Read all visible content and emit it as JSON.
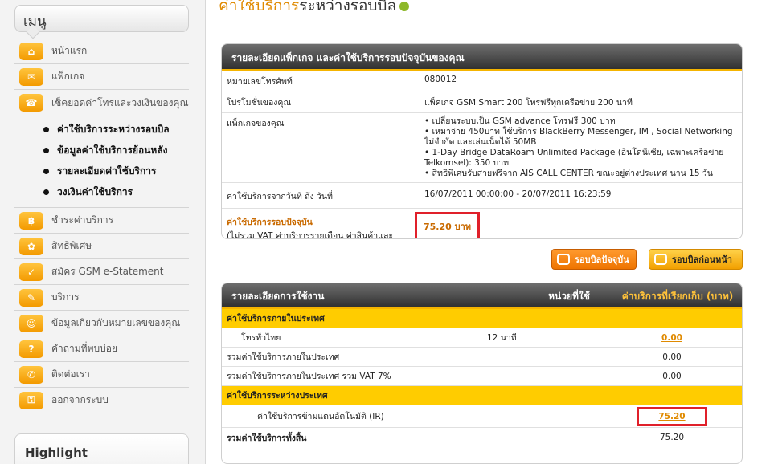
{
  "sidebar": {
    "menu_title": "เมนู",
    "items": [
      {
        "label": "หน้าแรก",
        "icon": "home-icon",
        "glyph": "⌂"
      },
      {
        "label": "แพ็กเกจ",
        "icon": "package-icon",
        "glyph": "✉"
      }
    ],
    "active_item": {
      "label": "เช็คยอดค่าโทรและวงเงินของคุณ",
      "icon": "phone-bill-icon",
      "glyph": "☎"
    },
    "sub_items": [
      "ค่าใช้บริการระหว่างรอบบิล",
      "ข้อมูลค่าใช้บริการย้อนหลัง",
      "รายละเอียดค่าใช้บริการ",
      "วงเงินค่าใช้บริการ"
    ],
    "items_after": [
      {
        "label": "ชำระค่าบริการ",
        "icon": "payment-icon",
        "glyph": "฿"
      },
      {
        "label": "สิทธิพิเศษ",
        "icon": "gift-icon",
        "glyph": "✿"
      },
      {
        "label": "สมัคร GSM e-Statement",
        "icon": "statement-icon",
        "glyph": "✓"
      },
      {
        "label": "บริการ",
        "icon": "service-icon",
        "glyph": "✎"
      },
      {
        "label": "ข้อมูลเกี่ยวกับหมายเลขของคุณ",
        "icon": "user-icon",
        "glyph": "☺"
      },
      {
        "label": "คำถามที่พบบ่อย",
        "icon": "faq-icon",
        "glyph": "?"
      },
      {
        "label": "ติดต่อเรา",
        "icon": "contact-icon",
        "glyph": "✆"
      },
      {
        "label": "ออกจากระบบ",
        "icon": "logout-icon",
        "glyph": "⚿"
      }
    ],
    "highlight_title": "Highlight"
  },
  "main": {
    "title_part1": "ค่าใช้บริการ",
    "title_part2": "ระหว่างรอบบิล",
    "package_panel": {
      "header": "รายละเอียดแพ็กเกจ และค่าใช้บริการรอบปัจจุบันของคุณ",
      "phone_label": "หมายเลขโทรศัพท์",
      "phone_value": "080012",
      "promo_label": "โปรโมชั่นของคุณ",
      "promo_value": "แพ็คเกจ GSM Smart 200 โทรฟรีทุกเครือข่าย 200 นาที",
      "pkg_label": "แพ็กเกจของคุณ",
      "pkg_items": [
        "• เปลี่ยนระบบเป็น GSM advance โทรฟรี 300 บาท",
        "• เหมาจ่าย 450บาท ใช้บริการ BlackBerry Messenger, IM , Social Networking ไม่จำกัด และเล่นเน็ตได้ 50MB",
        "• 1-Day Bridge DataRoam Unlimited Package (อินโดนีเซีย, เฉพาะเครือข่าย Telkomsel): 350 บาท",
        "• สิทธิพิเศษรับสายฟรีจาก AIS CALL CENTER ขณะอยู่ต่างประเทศ นาน 15 วัน"
      ],
      "period_label": "ค่าใช้บริการจากวันที่ ถึง วันที่",
      "period_value": "16/07/2011 00:00:00 - 20/07/2011 16:23:59",
      "current_label": "ค่าใช้บริการรอบปัจจุบัน",
      "current_note": "(ไม่รวม VAT ค่าบริการรายเดือน ค่าสินค้าและบริการ)",
      "current_value": "75.20 บาท"
    },
    "buttons": {
      "current_bill": "รอบบิลปัจจุบัน",
      "previous_bill": "รอบบิลก่อนหน้า"
    },
    "usage_panel": {
      "col_detail": "รายละเอียดการใช้งาน",
      "col_unit": "หน่วยที่ใช้",
      "col_charge": "ค่าบริการที่เรียกเก็บ (บาท)",
      "domestic_section": "ค่าใช้บริการภายในประเทศ",
      "domestic_call_label": "โทรทั่วไทย",
      "domestic_call_unit": "12 นาที",
      "domestic_call_value": "0.00",
      "domestic_total_label": "รวมค่าใช้บริการภายในประเทศ",
      "domestic_total_value": "0.00",
      "domestic_vat_label": "รวมค่าใช้บริการภายในประเทศ รวม VAT 7%",
      "domestic_vat_value": "0.00",
      "intl_section": "ค่าใช้บริการระหว่างประเทศ",
      "ir_label": "ค่าใช้บริการข้ามแดนอัตโนมัติ (IR)",
      "ir_value": "75.20",
      "grand_total_label": "รวมค่าใช้บริการทั้งสิ้น",
      "grand_total_value": "75.20"
    }
  }
}
